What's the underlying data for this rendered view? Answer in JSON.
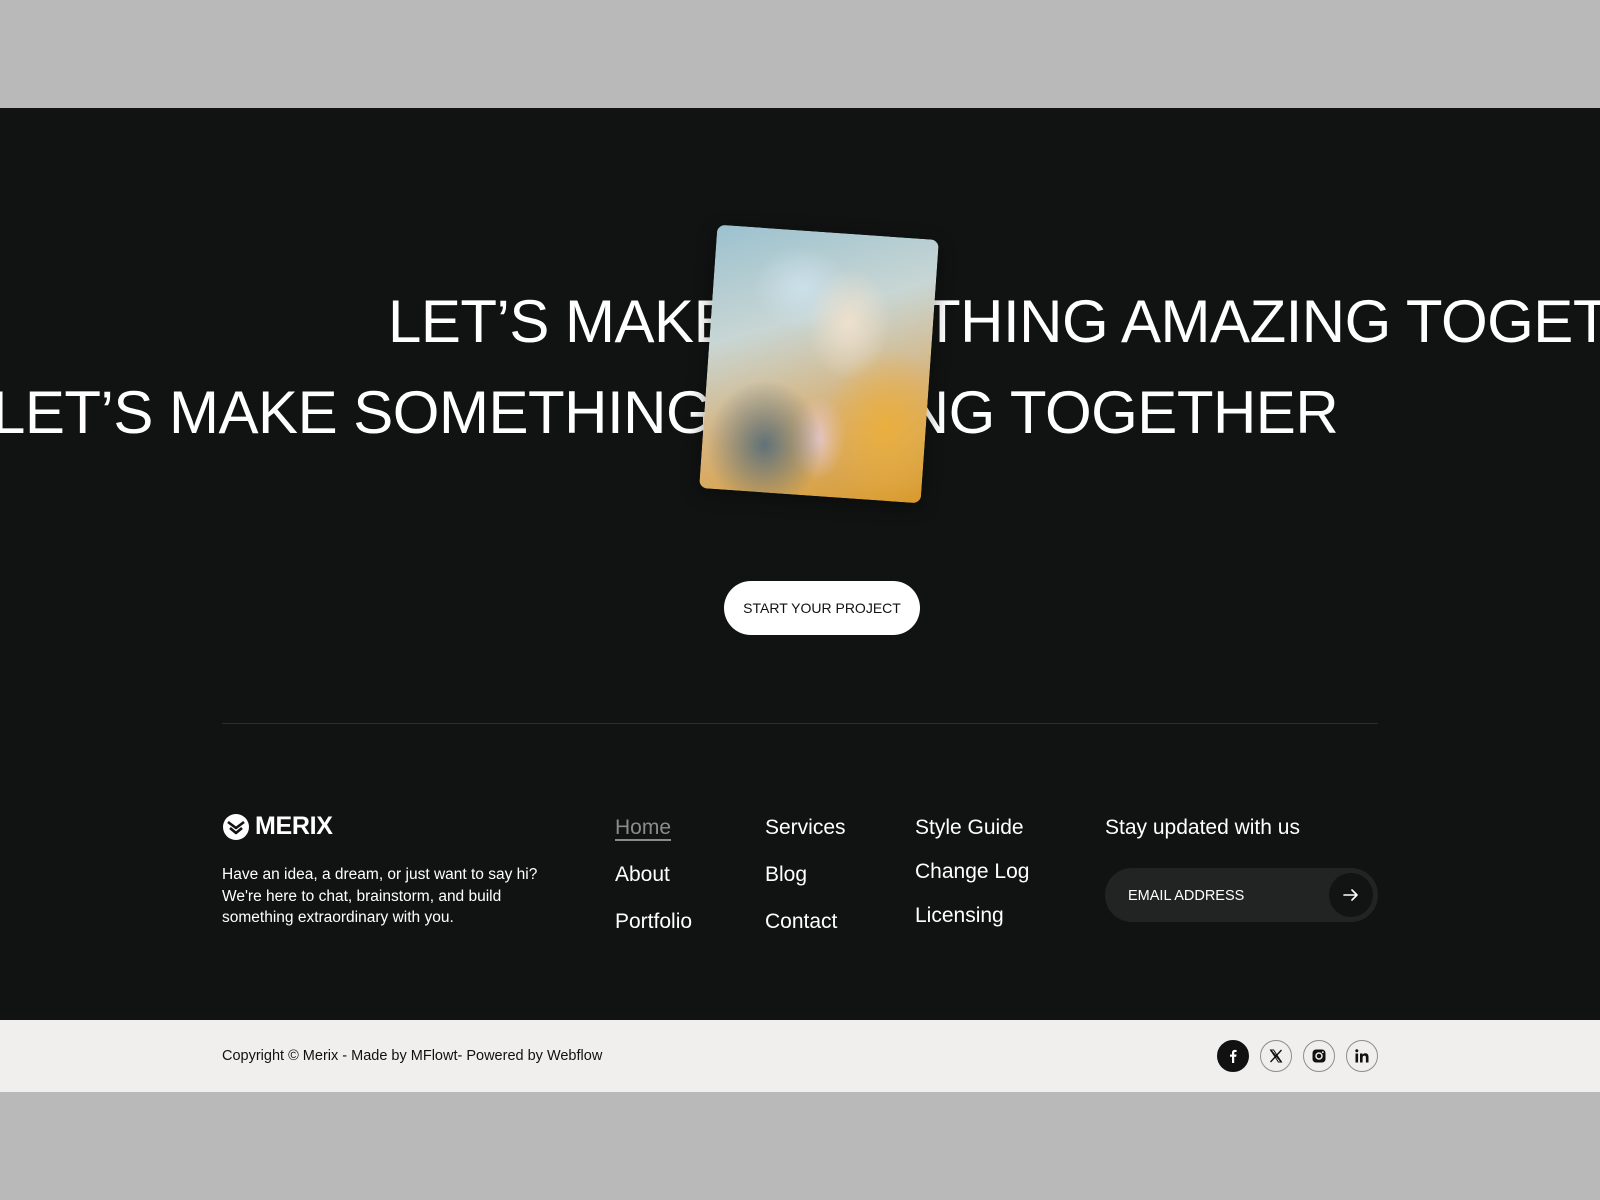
{
  "hero": {
    "marquee_line_1": "LET’S MAKE SOMETHING AMAZING TOGETHER",
    "marquee_line_2": "LET’S MAKE SOMETHING AMAZING TOGETHER",
    "cta_label": "START YOUR PROJECT"
  },
  "footer": {
    "brand_name": "MERIX",
    "tagline": "Have an idea, a dream, or just want to say hi? We're here to chat, brainstorm, and build something extraordinary with you.",
    "nav_columns": [
      [
        "Home",
        "About",
        "Portfolio"
      ],
      [
        "Services",
        "Blog",
        "Contact"
      ],
      [
        "Style Guide",
        "Change Log",
        "Licensing"
      ]
    ],
    "active_link": "Home",
    "newsletter_title": "Stay updated with us",
    "email_placeholder": "EMAIL ADDRESS",
    "copyright": "Copyright © Merix - Made  by MFlowt- Powered by Webflow",
    "socials": [
      "facebook-icon",
      "x-icon",
      "instagram-icon",
      "linkedin-icon"
    ]
  },
  "colors": {
    "page_bg": "#b9b9b9",
    "dark_bg": "#111312",
    "bottom_bar": "#f0efed",
    "active_link": "#8a8c8b"
  }
}
